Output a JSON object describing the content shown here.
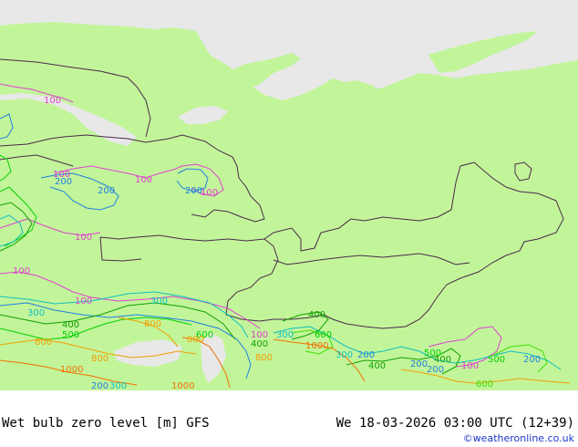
{
  "map": {
    "colors": {
      "sea": "#e8e8e8",
      "land": "#c2f59a",
      "border": "#4a2a4a",
      "c100": "#e040d0",
      "c200": "#2080e0",
      "c300": "#10c0c0",
      "c400": "#10a000",
      "c500": "#00d000",
      "c600": "#40e000",
      "c800": "#f0a000",
      "c1000": "#f07000"
    },
    "contour_labels": [
      {
        "id": "lbl-100-nw",
        "text": "100"
      },
      {
        "id": "lbl-100-a",
        "text": "100"
      },
      {
        "id": "lbl-200-a",
        "text": "200"
      },
      {
        "id": "lbl-200-b",
        "text": "200"
      },
      {
        "id": "lbl-100-b",
        "text": "100"
      },
      {
        "id": "lbl-200-c",
        "text": "200"
      },
      {
        "id": "lbl-100-c",
        "text": "100"
      },
      {
        "id": "lbl-100-d",
        "text": "100"
      },
      {
        "id": "lbl-100-e",
        "text": "100"
      },
      {
        "id": "lbl-100-f",
        "text": "100"
      },
      {
        "id": "lbl-300-a",
        "text": "300"
      },
      {
        "id": "lbl-300-b",
        "text": "300"
      },
      {
        "id": "lbl-400-a",
        "text": "400"
      },
      {
        "id": "lbl-500-a",
        "text": "500"
      },
      {
        "id": "lbl-600-a",
        "text": "600"
      },
      {
        "id": "lbl-800-a",
        "text": "800"
      },
      {
        "id": "lbl-800-b",
        "text": "800"
      },
      {
        "id": "lbl-1000-a",
        "text": "1000"
      },
      {
        "id": "lbl-800-c",
        "text": "800"
      },
      {
        "id": "lbl-200-d",
        "text": "200"
      },
      {
        "id": "lbl-300-c",
        "text": "300"
      },
      {
        "id": "lbl-1000-b",
        "text": "1000"
      },
      {
        "id": "lbl-100-g",
        "text": "100"
      },
      {
        "id": "lbl-300-d",
        "text": "300"
      },
      {
        "id": "lbl-400-b",
        "text": "400"
      },
      {
        "id": "lbl-600-b",
        "text": "600"
      },
      {
        "id": "lbl-400-c",
        "text": "400"
      },
      {
        "id": "lbl-800-d",
        "text": "800"
      },
      {
        "id": "lbl-800-e",
        "text": "800"
      },
      {
        "id": "lbl-1000-c",
        "text": "1000"
      },
      {
        "id": "lbl-300-e",
        "text": "300"
      },
      {
        "id": "lbl-200-e",
        "text": "200"
      },
      {
        "id": "lbl-400-d",
        "text": "400"
      },
      {
        "id": "lbl-200-f",
        "text": "200"
      },
      {
        "id": "lbl-400-e",
        "text": "400"
      },
      {
        "id": "lbl-500-b",
        "text": "500"
      },
      {
        "id": "lbl-200-g",
        "text": "200"
      },
      {
        "id": "lbl-100-h",
        "text": "100"
      },
      {
        "id": "lbl-500-c",
        "text": "500"
      },
      {
        "id": "lbl-200-h",
        "text": "200"
      },
      {
        "id": "lbl-600-c",
        "text": "600"
      }
    ]
  },
  "footer": {
    "title_left": "Wet bulb zero level [m] GFS",
    "title_right": "We 18-03-2026 03:00 UTC (12+39)",
    "credit": "©weatheronline.co.uk"
  }
}
